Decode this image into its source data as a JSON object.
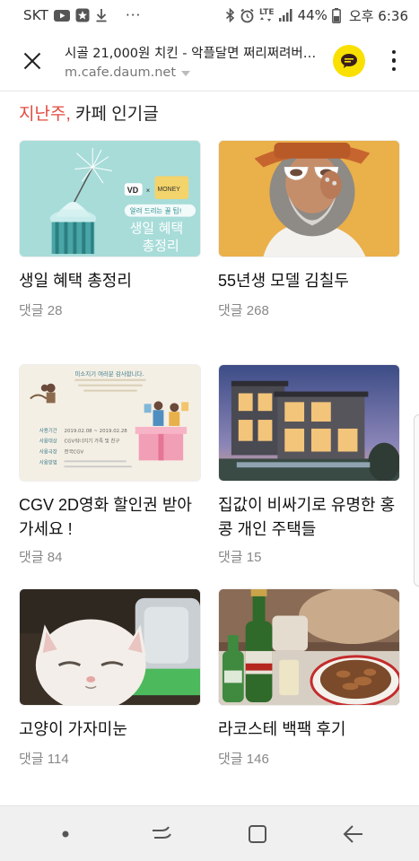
{
  "status_bar": {
    "carrier": "SKT",
    "lte_label": "LTE",
    "battery": "44%",
    "time": "오후 6:36",
    "more_dots": "···"
  },
  "header": {
    "title": "시골 21,000원 치킨 - 악플달면 쩌리쩌려버…",
    "url": "m.cafe.daum.net"
  },
  "section": {
    "heading_accent": "지난주,",
    "heading_rest": " 카페 인기글"
  },
  "cards": [
    {
      "title": "생일 혜택 총정리",
      "comments": "댓글 28",
      "thumb_text": {
        "line1": "생일 혜택",
        "line2": "총정리",
        "banner": "알려 드리는 꿀 팁!",
        "brand": "VD"
      }
    },
    {
      "title": "55년생 모델 김칠두",
      "comments": "댓글 268"
    },
    {
      "title": "CGV 2D영화 할인권 받아가세요 !",
      "comments": "댓글 84",
      "thumb_text": {
        "headline": "미소지기 여러분 감사합니다.",
        "sub1": "사용기간",
        "sub2": "사용대상",
        "sub3": "사용극장",
        "sub4": "사용방법",
        "v1": "2019.02.08 ~ 2019.02.28",
        "v2": "CGV워너지기 가족 및 친구",
        "v3": "전국CGV"
      }
    },
    {
      "title": "집값이 비싸기로 유명한 홍콩 개인 주택들",
      "comments": "댓글 15"
    },
    {
      "title": "고양이 가자미눈",
      "comments": "댓글 114"
    },
    {
      "title": "라코스테 백팩 후기",
      "comments": "댓글 146"
    }
  ],
  "colors": {
    "accent": "#e34a3f",
    "kakao_yellow": "#f9e000",
    "comment_gray": "#888888"
  }
}
